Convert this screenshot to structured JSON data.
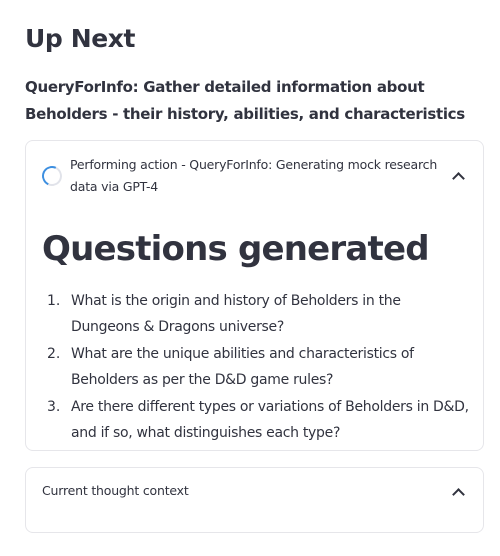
{
  "page": {
    "title": "Up Next",
    "subtitle": "QueryForInfo: Gather detailed information about Beholders - their history, abilities, and characteristics"
  },
  "action_expander": {
    "status_text": "Performing action - QueryForInfo: Generating mock research data via GPT-4",
    "icon": "spinner-icon",
    "toggle_icon": "chevron-up-icon",
    "heading": "Questions generated",
    "questions": [
      {
        "number": "1.",
        "text": "What is the origin and history of Beholders in the Dungeons & Dragons universe?"
      },
      {
        "number": "2.",
        "text": "What are the unique abilities and characteristics of Beholders as per the D&D game rules?"
      },
      {
        "number": "3.",
        "text": "Are there different types or variations of Beholders in D&D, and if so, what distinguishes each type?"
      }
    ]
  },
  "context_expander": {
    "label": "Current thought context",
    "toggle_icon": "chevron-up-icon"
  },
  "colors": {
    "text": "#31333f",
    "border": "#e6e6ea",
    "spinner_accent": "#3d8fe0",
    "spinner_track": "#e1e3ea"
  }
}
